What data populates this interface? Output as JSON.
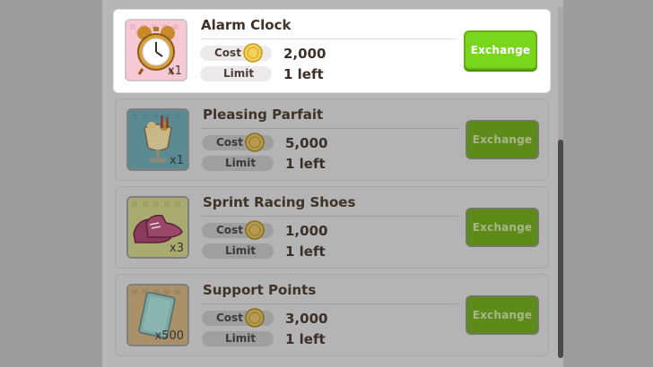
{
  "shop": {
    "exchange_label": "Exchange",
    "cost_label": "Cost",
    "limit_label": "Limit",
    "items": [
      {
        "name": "Alarm Clock",
        "quantity": "x1",
        "cost": "2,000",
        "limit": "1 left",
        "icon": "alarm-clock-icon",
        "highlighted": true,
        "bg": "#f4c6d3"
      },
      {
        "name": "Pleasing Parfait",
        "quantity": "x1",
        "cost": "5,000",
        "limit": "1 left",
        "icon": "parfait-icon",
        "highlighted": false,
        "bg": "#5b8a93"
      },
      {
        "name": "Sprint Racing Shoes",
        "quantity": "x3",
        "cost": "1,000",
        "limit": "1 left",
        "icon": "racing-shoes-icon",
        "highlighted": false,
        "bg": "#a9aa70"
      },
      {
        "name": "Support Points",
        "quantity": "x500",
        "cost": "3,000",
        "limit": "1 left",
        "icon": "support-points-icon",
        "highlighted": false,
        "bg": "#a99068"
      }
    ]
  },
  "colors": {
    "exchange_active": "#7ad61c",
    "exchange_dimmed": "#5e8a1a",
    "overlay": "#9d9d9d"
  }
}
